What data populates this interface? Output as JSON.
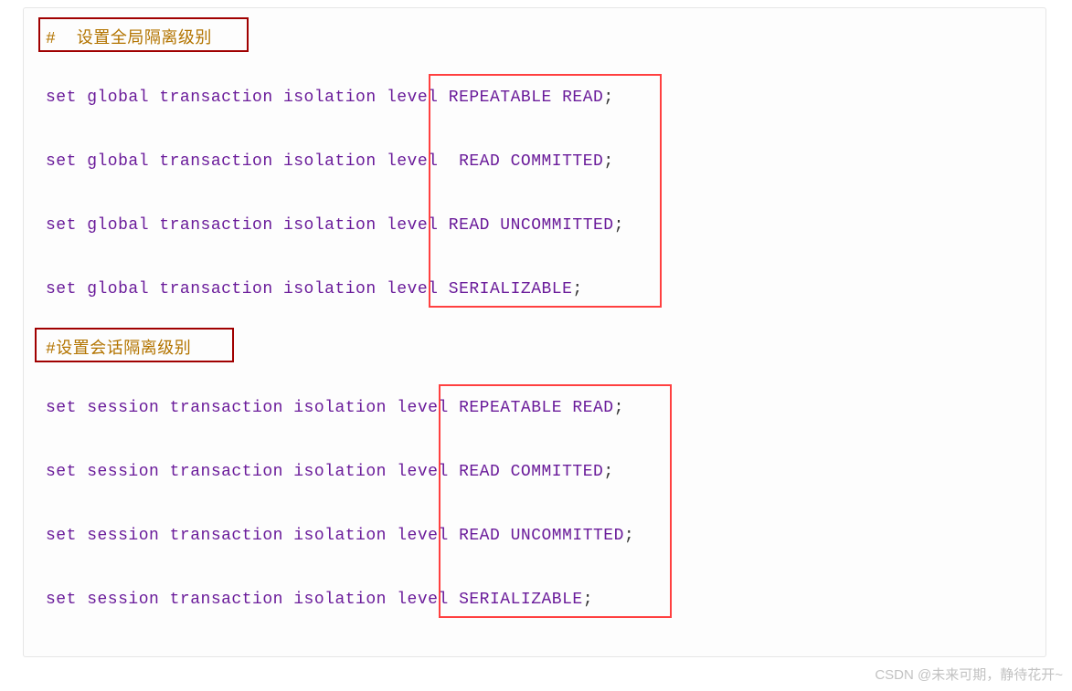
{
  "comment1": "#  设置全局隔离级别",
  "comment2": "#设置会话隔离级别",
  "global": {
    "prefix": "set global transaction isolation level ",
    "levels": [
      "REPEATABLE READ",
      " READ COMMITTED",
      "READ UNCOMMITTED",
      "SERIALIZABLE"
    ]
  },
  "session": {
    "prefix": "set session transaction isolation level ",
    "levels": [
      "REPEATABLE READ",
      "READ COMMITTED",
      "READ UNCOMMITTED",
      "SERIALIZABLE"
    ]
  },
  "semicolon": ";",
  "watermark": "CSDN @未来可期，静待花开~"
}
